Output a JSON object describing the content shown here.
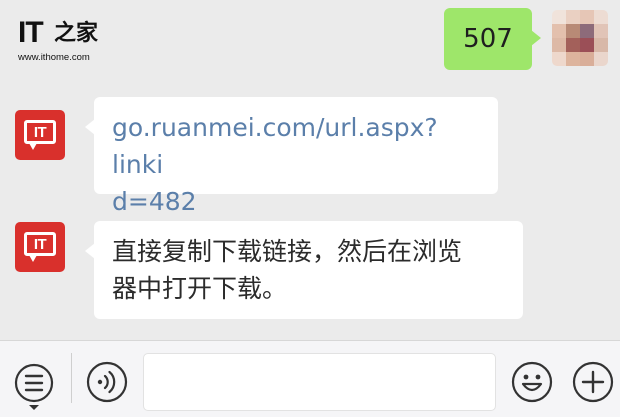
{
  "watermark": {
    "logo": "IT",
    "chinese": "之家",
    "url": "www.ithome.com"
  },
  "messages": [
    {
      "sender": "me",
      "text": "507"
    },
    {
      "sender": "IT之家",
      "avatar_text": "IT",
      "type": "link",
      "text": "go.ruanmei.com/url.aspx?linkid=482",
      "lines": [
        "go.ruanmei.com/url.aspx?linki",
        "d=482"
      ]
    },
    {
      "sender": "IT之家",
      "avatar_text": "IT",
      "type": "text",
      "text": "直接复制下载链接，然后在浏览器中打开下载。",
      "lines": [
        "直接复制下载链接，然后在浏览",
        "器中打开下载。"
      ]
    }
  ],
  "toolbar": {
    "menu_icon": "list-menu-icon",
    "voice_icon": "voice-icon",
    "emoji_icon": "smiley-emoji-icon",
    "add_icon": "plus-add-icon",
    "input_value": ""
  },
  "colors": {
    "background": "#ebebeb",
    "my_bubble": "#9ee66a",
    "brand_red": "#d9302c",
    "link": "#5b7faa"
  }
}
